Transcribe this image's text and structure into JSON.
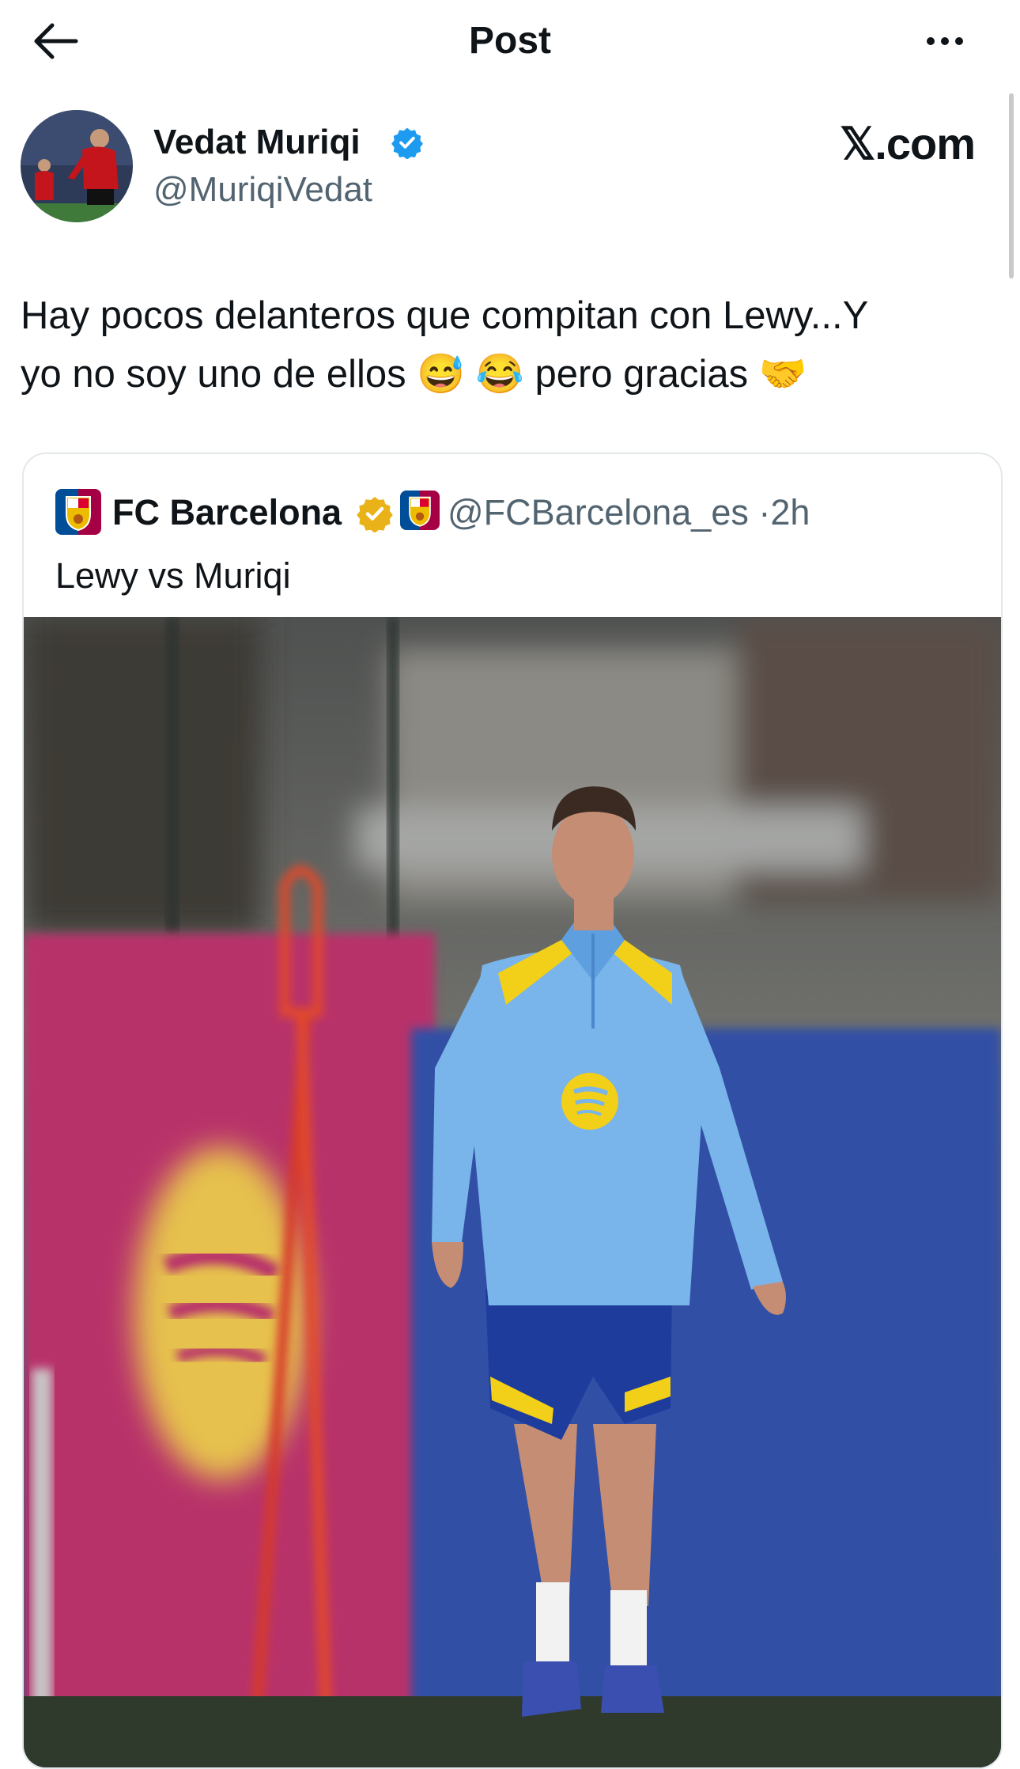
{
  "header": {
    "title": "Post"
  },
  "author": {
    "name": "Vedat Muriqi",
    "handle": "@MuriqiVedat"
  },
  "site_label": "𝕏.com",
  "post": {
    "line1": "Hay pocos delanteros que compitan con Lewy...Y",
    "line2_before": "yo no soy uno de ellos",
    "emojis_mid": "😅 😂",
    "line2_after": "pero gracias",
    "emoji_end": "🤝"
  },
  "quoted": {
    "name": "FC Barcelona",
    "handle": "@FCBarcelona_es",
    "separator": "·",
    "time": "2h",
    "text": "Lewy vs Muriqi"
  },
  "colors": {
    "verified_blue": "#1d9bf0",
    "org_gold": "#e9b219",
    "muted": "#536471"
  },
  "icons": [
    "back-arrow-icon",
    "more-icon",
    "verified-badge-icon",
    "org-badge-icon",
    "barcelona-crest-icon"
  ]
}
